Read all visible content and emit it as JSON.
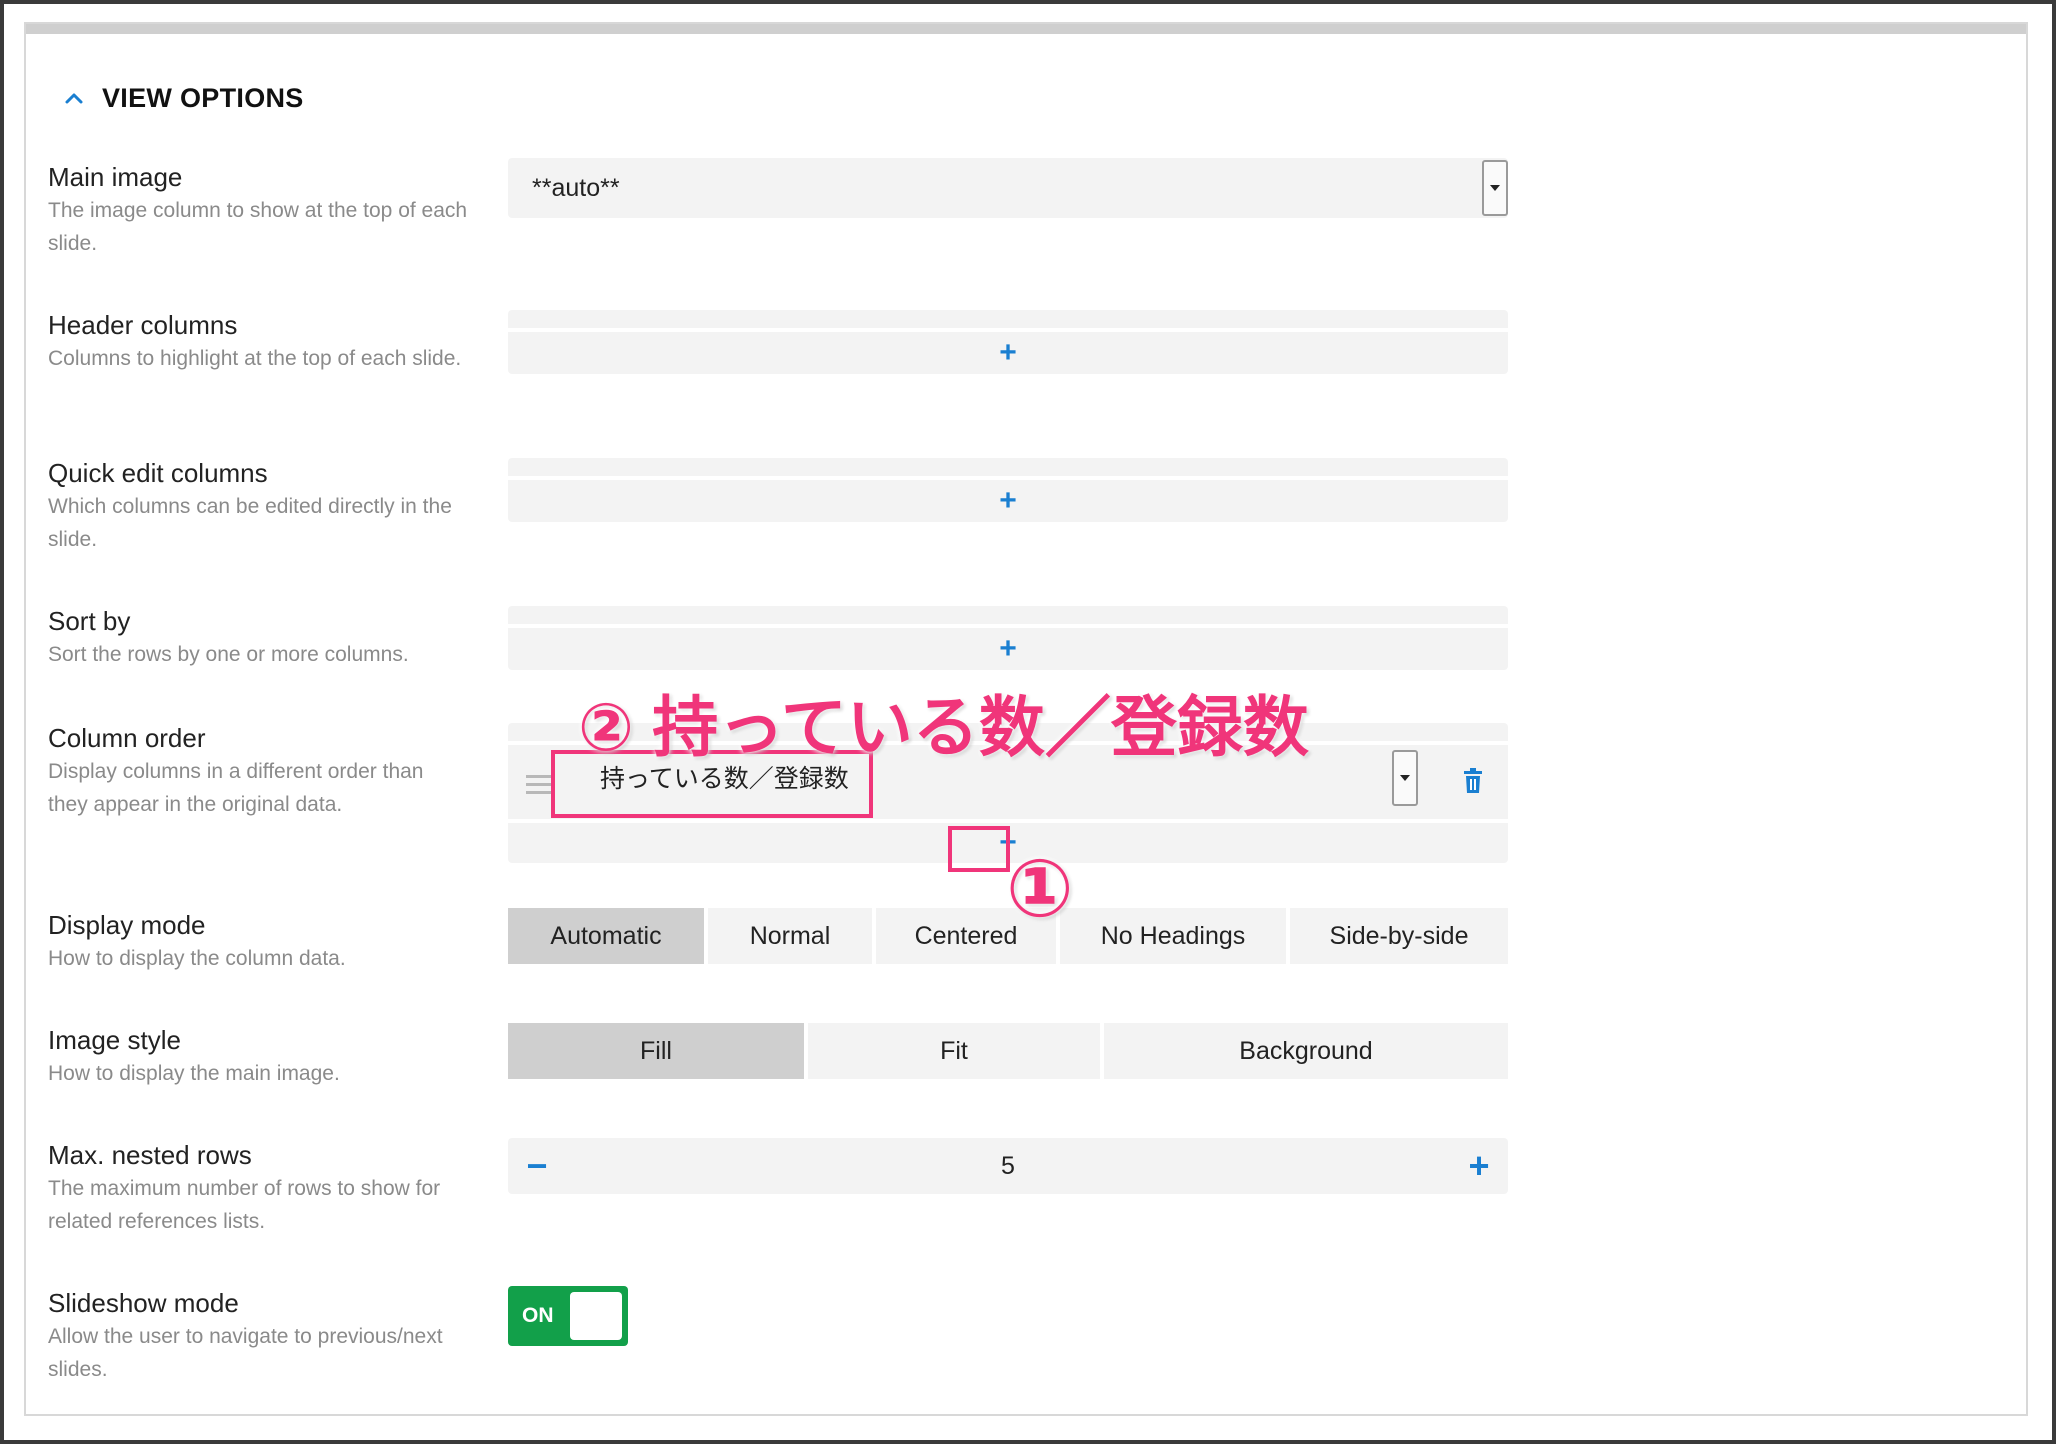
{
  "section": {
    "title": "VIEW OPTIONS"
  },
  "fields": {
    "main_image": {
      "title": "Main image",
      "desc": "The image column to show at the top of each slide.",
      "value": "**auto**"
    },
    "header_columns": {
      "title": "Header columns",
      "desc": "Columns to highlight at the top of each slide."
    },
    "quick_edit": {
      "title": "Quick edit columns",
      "desc": "Which columns can be edited directly in the slide."
    },
    "sort_by": {
      "title": "Sort by",
      "desc": "Sort the rows by one or more columns."
    },
    "column_order": {
      "title": "Column order",
      "desc": "Display columns in a different order than they appear in the original data.",
      "item_value": "持っている数／登録数"
    },
    "display_mode": {
      "title": "Display mode",
      "desc": "How to display the column data.",
      "options": [
        "Automatic",
        "Normal",
        "Centered",
        "No Headings",
        "Side-by-side"
      ],
      "selected": "Automatic"
    },
    "image_style": {
      "title": "Image style",
      "desc": "How to display the main image.",
      "options": [
        "Fill",
        "Fit",
        "Background"
      ],
      "selected": "Fill"
    },
    "max_nested": {
      "title": "Max. nested rows",
      "desc": "The maximum number of rows to show for related references lists.",
      "value": "5"
    },
    "slideshow": {
      "title": "Slideshow mode",
      "desc": "Allow the user to navigate to previous/next slides.",
      "toggle_label": "ON",
      "on": true
    }
  },
  "annotations": {
    "step1": "①",
    "step2": "② 持っている数／登録数"
  },
  "colors": {
    "accent": "#1a7fd1",
    "toggle_on": "#12a04a",
    "annotation": "#f0357a",
    "segment_active": "#cfcfcf",
    "field_bg": "#f3f3f3"
  },
  "icons": {
    "collapse": "chevron-up-icon",
    "drag": "drag-handle-icon",
    "delete": "trash-icon",
    "add": "plus-icon",
    "decrement": "minus-icon",
    "increment": "plus-icon"
  }
}
